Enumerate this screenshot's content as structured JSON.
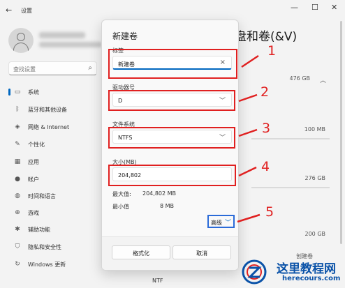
{
  "window": {
    "app_title": "设置",
    "heading_partial": "盘和卷(&V)",
    "sizes": [
      "476 GB",
      "100 MB",
      "276 GB",
      "200 GB"
    ],
    "create_volume_partial": "创建卷",
    "ntfs_partial": "NTF"
  },
  "search": {
    "placeholder": "查找设置"
  },
  "sidebar": {
    "items": [
      {
        "label": "系统",
        "icon": "monitor-icon"
      },
      {
        "label": "蓝牙和其他设备",
        "icon": "bluetooth-icon"
      },
      {
        "label": "网络 & Internet",
        "icon": "network-icon"
      },
      {
        "label": "个性化",
        "icon": "brush-icon"
      },
      {
        "label": "应用",
        "icon": "apps-icon"
      },
      {
        "label": "帐户",
        "icon": "account-icon"
      },
      {
        "label": "时间和语言",
        "icon": "globe-icon"
      },
      {
        "label": "游戏",
        "icon": "gamepad-icon"
      },
      {
        "label": "辅助功能",
        "icon": "accessibility-icon"
      },
      {
        "label": "隐私和安全性",
        "icon": "shield-icon"
      },
      {
        "label": "Windows 更新",
        "icon": "update-icon"
      }
    ]
  },
  "dialog": {
    "title": "新建卷",
    "label_field": {
      "label": "标签",
      "value": "新建卷"
    },
    "drive_letter": {
      "label": "驱动器号",
      "value": "D"
    },
    "filesystem": {
      "label": "文件系统",
      "value": "NTFS"
    },
    "size": {
      "label": "大小(MB)",
      "value": "204,802"
    },
    "max": {
      "label": "最大值:",
      "value": "204,802 MB"
    },
    "min": {
      "label": "最小值",
      "value": "8 MB"
    },
    "advanced_label": "高级",
    "format_button": "格式化",
    "cancel_button": "取消"
  },
  "annotations": {
    "numbers": [
      "1",
      "2",
      "3",
      "4",
      "5"
    ],
    "color": "#e02020"
  },
  "watermark": {
    "cn": "这里教程网",
    "en": "herecours.com"
  },
  "colors": {
    "accent": "#0067c0",
    "annotation": "#e02020",
    "watermark": "#0a52a8"
  }
}
